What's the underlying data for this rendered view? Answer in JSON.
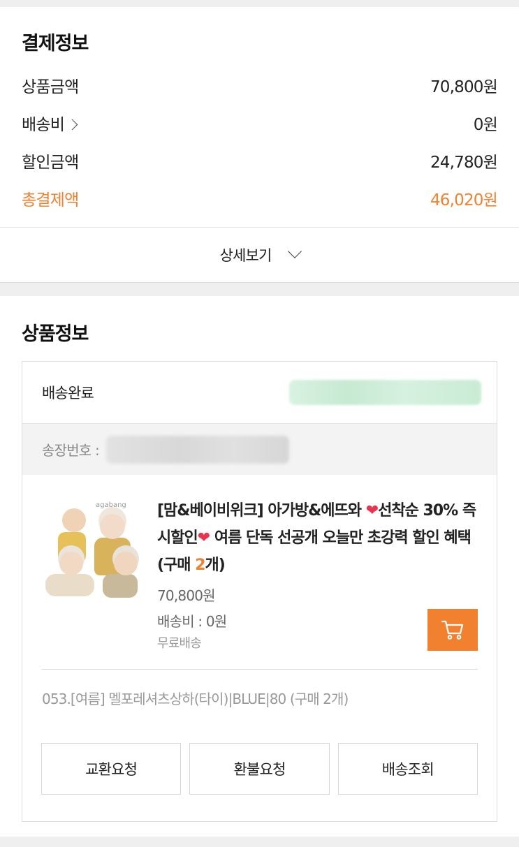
{
  "payment": {
    "title": "결제정보",
    "rows": [
      {
        "label": "상품금액",
        "value": "70,800원"
      },
      {
        "label": "배송비",
        "value": "0원"
      },
      {
        "label": "할인금액",
        "value": "24,780원"
      },
      {
        "label": "총결제액",
        "value": "46,020원"
      }
    ],
    "detail_label": "상세보기",
    "accent_color": "#f2812f"
  },
  "product": {
    "title": "상품정보",
    "status": "배송완료",
    "invoice_label": "송장번호 :",
    "brand_mini": "agabang",
    "name_part1": "[맘&베이비위크] 아가방&에뜨와 ",
    "heart1": "❤",
    "name_part2": "선착순 30% 즉시할인",
    "heart2": "❤",
    "name_part3": " 여름 단독 선공개 오늘만 초강력 할인 혜택 (구매 ",
    "qty": "2",
    "name_part4": "개)",
    "price": "70,800원",
    "shipping_fee": "배송비 : 0원",
    "shipping_type": "무료배송",
    "option": "053.[여름] 멜포레셔츠상하(타이)|BLUE|80 (구매 2개)",
    "cart_icon": "cart-icon",
    "buttons": {
      "exchange": "교환요청",
      "refund": "환불요청",
      "tracking": "배송조회"
    }
  }
}
